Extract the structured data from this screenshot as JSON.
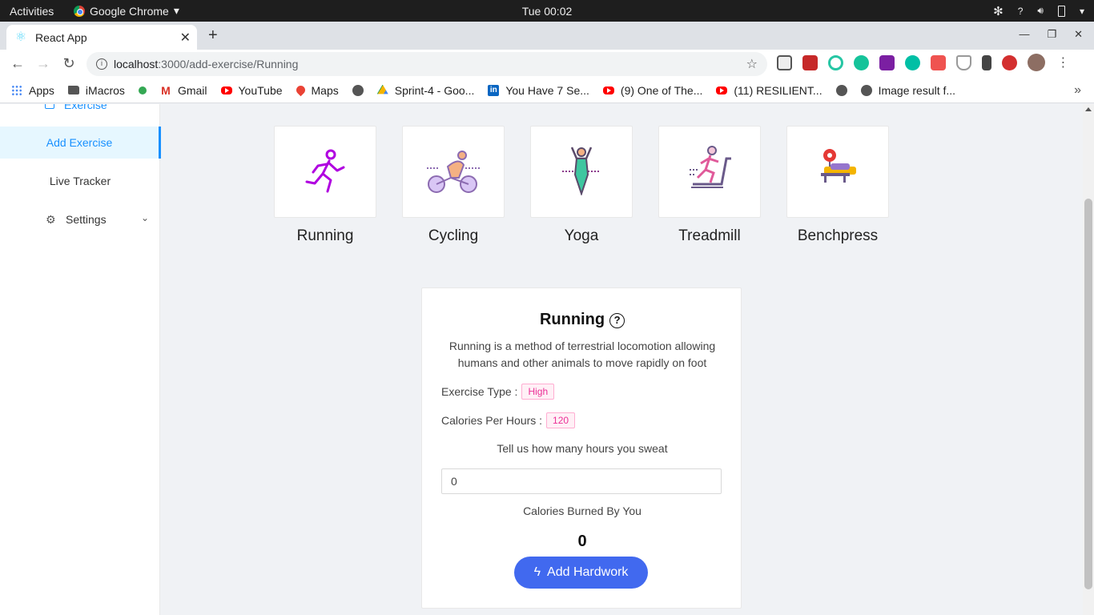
{
  "system_bar": {
    "activities": "Activities",
    "app_name": "Google Chrome",
    "clock": "Tue 00:02",
    "tray_question": "?"
  },
  "browser": {
    "tab_title": "React App",
    "url_host": "localhost",
    "url_path": ":3000/add-exercise/Running",
    "bookmarks": [
      {
        "label": "Apps",
        "icon": "apps-grid-icon"
      },
      {
        "label": "iMacros",
        "icon": "folder-icon"
      },
      {
        "label": "",
        "icon": "android-icon"
      },
      {
        "label": "Gmail",
        "icon": "gmail-icon"
      },
      {
        "label": "YouTube",
        "icon": "youtube-icon"
      },
      {
        "label": "Maps",
        "icon": "maps-icon"
      },
      {
        "label": "",
        "icon": "globe-icon"
      },
      {
        "label": "Sprint-4 - Goo...",
        "icon": "drive-icon"
      },
      {
        "label": "You Have 7 Se...",
        "icon": "linkedin-icon"
      },
      {
        "label": "(9) One of The...",
        "icon": "youtube-icon"
      },
      {
        "label": "(11) RESILIENT...",
        "icon": "youtube-icon"
      },
      {
        "label": "",
        "icon": "globe-icon"
      },
      {
        "label": "Image result f...",
        "icon": "globe-icon"
      }
    ]
  },
  "sidebar": {
    "exercise_label": "Exercise",
    "items": [
      {
        "label": "Add Exercise",
        "active": true
      },
      {
        "label": "Live Tracker",
        "active": false
      }
    ],
    "settings_label": "Settings"
  },
  "exercises": [
    {
      "name": "Running",
      "icon": "running-icon"
    },
    {
      "name": "Cycling",
      "icon": "cycling-icon"
    },
    {
      "name": "Yoga",
      "icon": "yoga-icon"
    },
    {
      "name": "Treadmill",
      "icon": "treadmill-icon"
    },
    {
      "name": "Benchpress",
      "icon": "benchpress-icon"
    }
  ],
  "detail": {
    "title": "Running",
    "description": "Running is a method of terrestrial locomotion allowing humans and other animals to move rapidly on foot",
    "exercise_type_label": "Exercise Type :",
    "exercise_type_value": "High",
    "calories_label": "Calories Per Hours :",
    "calories_value": "120",
    "prompt": "Tell us how many hours you sweat",
    "hours_value": "0",
    "burned_label": "Calories Burned By You",
    "burned_value": "0",
    "button_label": "Add Hardwork"
  },
  "colors": {
    "accent": "#1890ff",
    "button": "#4169ef",
    "tag_text": "#eb2f96",
    "tag_bg": "#fff0f6"
  }
}
